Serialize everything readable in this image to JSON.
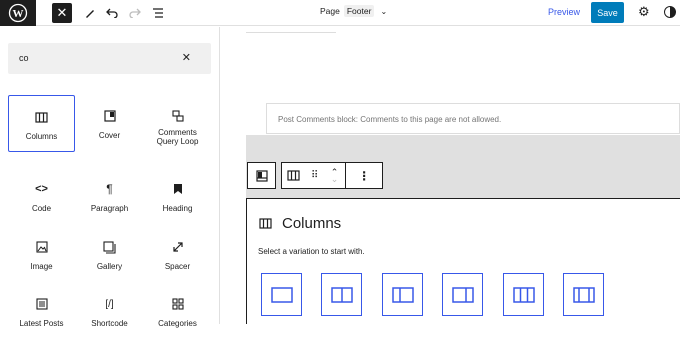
{
  "topbar": {
    "page_label": "Page",
    "template_badge": "Footer",
    "preview_label": "Preview",
    "save_label": "Save"
  },
  "sidebar": {
    "search_value": "co",
    "blocks": [
      {
        "label": "Columns",
        "icon": "columns-icon",
        "selected": true
      },
      {
        "label": "Cover",
        "icon": "cover-icon"
      },
      {
        "label": "Comments Query Loop",
        "icon": "comments-query-loop-icon"
      },
      {
        "label": "Code",
        "icon": "code-icon"
      },
      {
        "label": "Paragraph",
        "icon": "paragraph-icon"
      },
      {
        "label": "Heading",
        "icon": "heading-icon"
      },
      {
        "label": "Image",
        "icon": "image-icon"
      },
      {
        "label": "Gallery",
        "icon": "gallery-icon"
      },
      {
        "label": "Spacer",
        "icon": "spacer-icon"
      },
      {
        "label": "Latest Posts",
        "icon": "latest-posts-icon"
      },
      {
        "label": "Shortcode",
        "icon": "shortcode-icon"
      },
      {
        "label": "Categories",
        "icon": "categories-icon"
      }
    ]
  },
  "canvas": {
    "comments_notice": "Post Comments block: Comments to this page are not allowed.",
    "placeholder_title": "Columns",
    "placeholder_instructions": "Select a variation to start with."
  },
  "colors": {
    "accent": "#3858e9",
    "save": "#007cba",
    "dark": "#1e1e1e"
  }
}
